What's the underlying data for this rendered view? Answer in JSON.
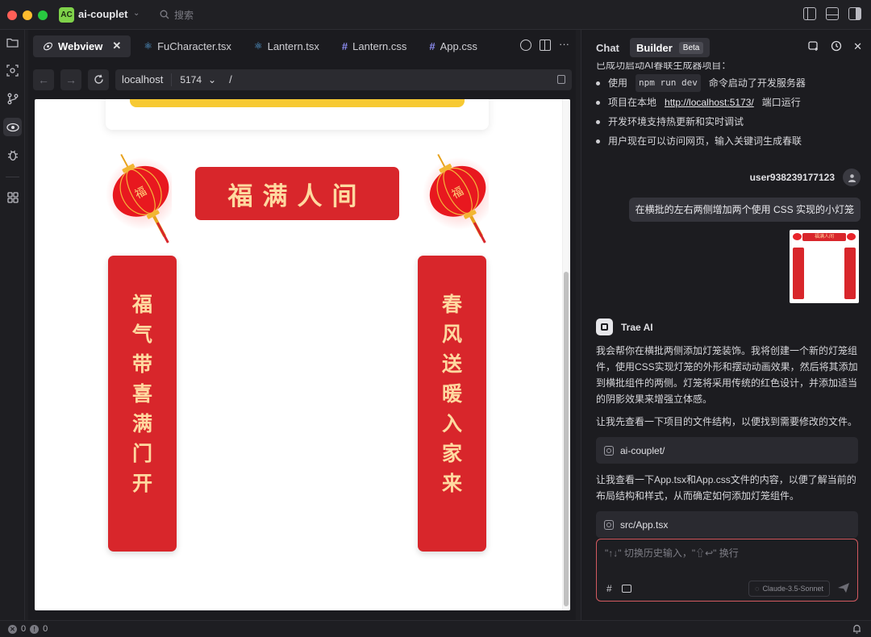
{
  "titlebar": {
    "app_badge": "AC",
    "app_name": "ai-couplet",
    "search_placeholder": "搜索"
  },
  "editor": {
    "tabs": [
      {
        "label": "Webview",
        "icon": "eye-link-icon",
        "active": true
      },
      {
        "label": "FuCharacter.tsx",
        "icon": "react-icon"
      },
      {
        "label": "Lantern.tsx",
        "icon": "react-icon"
      },
      {
        "label": "Lantern.css",
        "icon": "hash-icon"
      },
      {
        "label": "App.css",
        "icon": "hash-icon"
      }
    ],
    "url": {
      "host": "localhost",
      "port": "5174",
      "path": "/"
    }
  },
  "webview": {
    "hengpi": "福满人间",
    "lantern_char": "福",
    "left_couplet": [
      "福",
      "气",
      "带",
      "喜",
      "满",
      "门",
      "开"
    ],
    "right_couplet": [
      "春",
      "风",
      "送",
      "暖",
      "入",
      "家",
      "来"
    ],
    "thumb_hengpi": "福满人间"
  },
  "chat": {
    "tab_chat": "Chat",
    "tab_builder": "Builder",
    "beta": "Beta",
    "intro_line": "已成功启动AI春联生成器项目：",
    "bullets": [
      {
        "pre": "使用",
        "code": "npm run dev",
        "post": "命令启动了开发服务器"
      },
      {
        "pre": "项目在本地",
        "link": "http://localhost:5173/",
        "post": "端口运行"
      },
      {
        "pre": "开发环境支持热更新和实时调试"
      },
      {
        "pre": "用户现在可以访问网页，输入关键词生成春联"
      }
    ],
    "user_name": "user938239177123",
    "user_message": "在横批的左右两侧增加两个使用 CSS 实现的小灯笼",
    "ai_name": "Trae AI",
    "ai_para1": "我会帮你在横批两侧添加灯笼装饰。我将创建一个新的灯笼组件，使用CSS实现灯笼的外形和摆动动画效果，然后将其添加到横批组件的两侧。灯笼将采用传统的红色设计，并添加适当的阴影效果来增强立体感。",
    "ai_para2": "让我先查看一下项目的文件结构，以便找到需要修改的文件。",
    "file1": "ai-couplet/",
    "ai_para3": "让我查看一下App.tsx和App.css文件的内容，以便了解当前的布局结构和样式，从而确定如何添加灯笼组件。",
    "file2": "src/App.tsx",
    "input_placeholder": "\"↑↓\" 切换历史输入，\"⇧↩\" 换行",
    "model": "Claude-3.5-Sonnet"
  },
  "statusbar": {
    "errors": "0",
    "warnings": "0"
  },
  "colors": {
    "couplet_red": "#d8262b",
    "gold_text": "#ffd9a0",
    "accent_border": "#d35a60"
  }
}
